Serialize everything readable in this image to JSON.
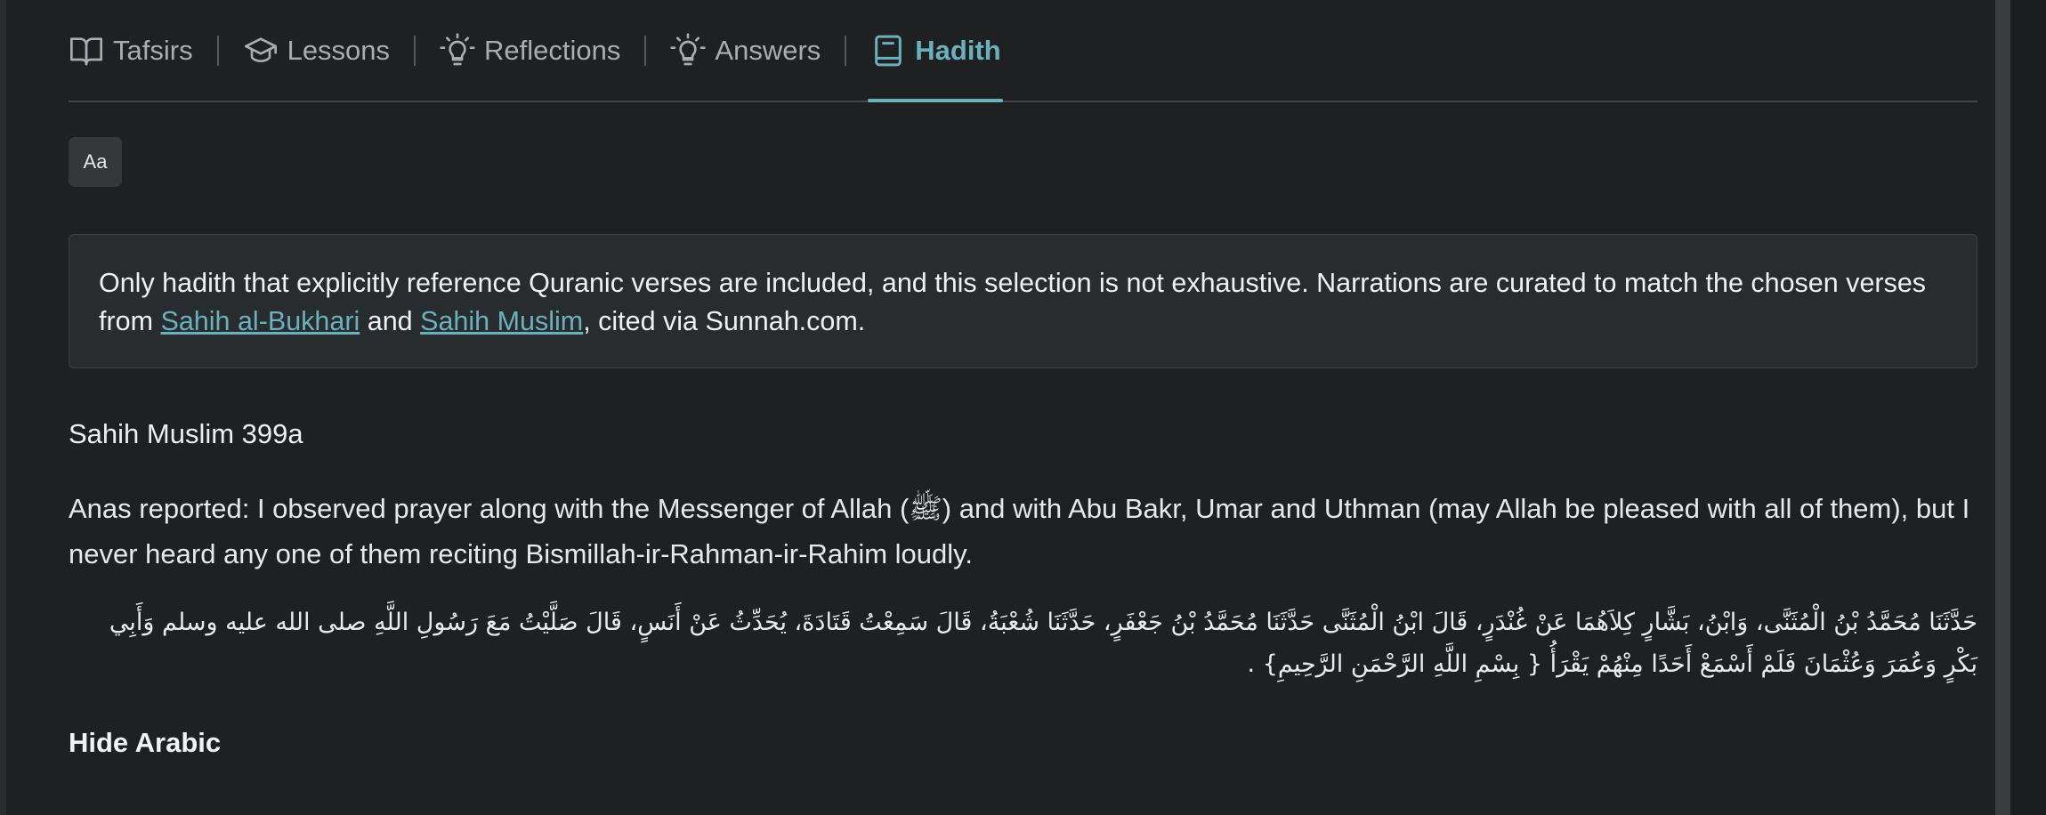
{
  "tabs": [
    {
      "label": "Tafsirs",
      "icon": "book-open-icon"
    },
    {
      "label": "Lessons",
      "icon": "graduation-cap-icon"
    },
    {
      "label": "Reflections",
      "icon": "lightbulb-icon"
    },
    {
      "label": "Answers",
      "icon": "lightbulb-icon"
    },
    {
      "label": "Hadith",
      "icon": "book-icon",
      "active": true
    }
  ],
  "font_button": {
    "label": "Aa"
  },
  "notice": {
    "text_before": "Only hadith that explicitly reference Quranic verses are included, and this selection is not exhaustive. Narrations are curated to match the chosen verses from ",
    "link1": "Sahih al-Bukhari",
    "text_between": " and ",
    "link2": "Sahih Muslim",
    "text_after": ", cited via Sunnah.com."
  },
  "hadith": {
    "title": "Sahih Muslim 399a",
    "english": "Anas reported: I observed prayer along with the Messenger of Allah (ﷺ) and with Abu Bakr, Umar and Uthman (may Allah be pleased with all of them), but I never heard any one of them reciting Bismillah-ir-Rahman-ir-Rahim loudly.",
    "arabic": "حَدَّثَنَا مُحَمَّدُ بْنُ الْمُثَنَّى، وَابْنُ، بَشَّارٍ كِلاَهُمَا عَنْ غُنْدَرٍ، قَالَ ابْنُ الْمُثَنَّى حَدَّثَنَا مُحَمَّدُ بْنُ جَعْفَرٍ، حَدَّثَنَا شُعْبَةُ، قَالَ سَمِعْتُ قَتَادَةَ، يُحَدِّثُ عَنْ أَنَسٍ، قَالَ صَلَّيْتُ مَعَ رَسُولِ اللَّهِ صلى الله عليه وسلم وَأَبِي بَكْرٍ وَعُمَرَ وَعُثْمَانَ فَلَمْ أَسْمَعْ أَحَدًا مِنْهُمْ يَقْرَأُ ‏{‏ بِسْمِ اللَّهِ الرَّحْمَنِ الرَّحِيمِ‏}‏ ‏.‏",
    "toggle_label": "Hide Arabic"
  },
  "colors": {
    "accent": "#6ab0bd",
    "background": "#1f2022"
  }
}
